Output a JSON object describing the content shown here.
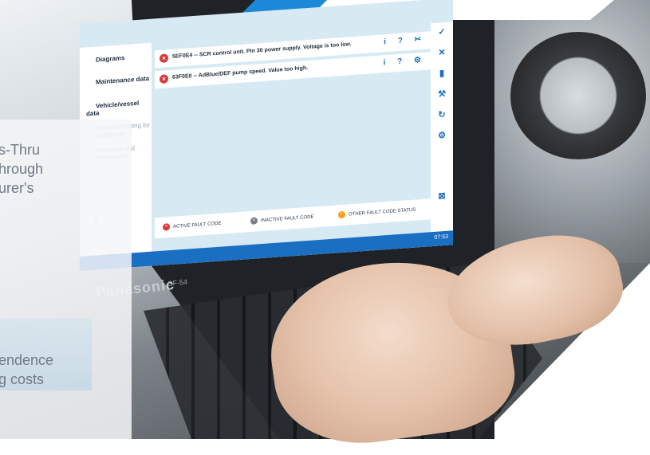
{
  "screen": {
    "sidebar": {
      "items": [
        {
          "label": "Diagrams",
          "dim": false
        },
        {
          "label": "Maintenance data",
          "dim": false
        },
        {
          "label": "Vehicle/vessel data",
          "dim": false
        },
        {
          "label": "Troubleshooting by symptoms",
          "dim": true
        },
        {
          "label": "Releases and Procedures",
          "dim": true
        }
      ],
      "back_label": "‹"
    },
    "faults": [
      {
        "code": "5EF0E4",
        "text": "5EF0E4 -- SCR control unit. Pin 30 power supply. Voltage is too low.",
        "tools": "i ? ✂"
      },
      {
        "code": "63F0E0",
        "text": "63F0E0 -- AdBlue/DEF pump speed. Value too high.",
        "tools": "i ? ⚙"
      }
    ],
    "legend": {
      "active": "ACTIVE FAULT CODE",
      "inactive": "INACTIVE FAULT CODE",
      "other": "OTHER FAULT CODE STATUS"
    },
    "toolbar_icons": [
      "check-icon",
      "close-icon",
      "trash-icon",
      "wrench-icon",
      "refresh-icon",
      "engine-icon"
    ],
    "clock": "07:53",
    "colors": {
      "accent": "#1a6fc2",
      "active": "#d93a3a",
      "inactive": "#7a7f85",
      "other": "#f2a21b",
      "screen_bg": "#d7eaf4"
    }
  },
  "laptop": {
    "brand": "Panasonic",
    "model": "CF-54"
  },
  "overlay_text": {
    "lines_top": [
      "s-Thru",
      "hrough",
      "urer's"
    ],
    "lines_bottom": [
      "endence",
      "g costs"
    ]
  }
}
